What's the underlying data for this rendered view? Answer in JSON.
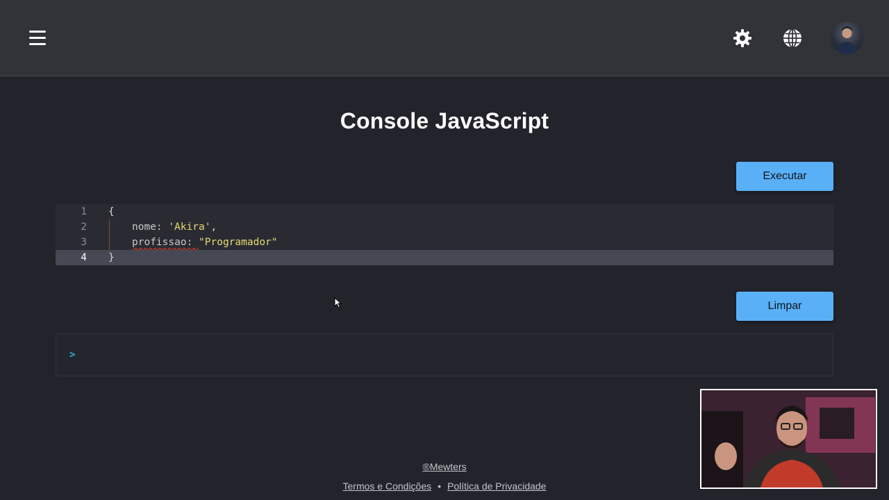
{
  "header": {
    "menu_icon": "hamburger-menu-icon",
    "settings_icon": "gear-icon",
    "language_icon": "globe-icon",
    "avatar_icon": "user-avatar"
  },
  "main": {
    "title": "Console JavaScript",
    "run_button_label": "Executar",
    "clear_button_label": "Limpar"
  },
  "editor": {
    "lines": [
      {
        "number": "1",
        "open": "{"
      },
      {
        "number": "2",
        "key": "nome: ",
        "value": "'Akira'",
        "punct": ","
      },
      {
        "number": "3",
        "key": "profissao: ",
        "value": "\"Programador\""
      },
      {
        "number": "4",
        "close": "}"
      }
    ],
    "active_line": "4"
  },
  "console": {
    "prompt_symbol": ">"
  },
  "footer": {
    "brand": "®Mewters",
    "terms_label": "Termos e Condições",
    "separator": "•",
    "privacy_label": "Política de Privacidade"
  },
  "colors": {
    "background": "#22232b",
    "header": "#323338",
    "accent_button": "#5ab0f7",
    "string_token": "#e6db74",
    "prompt": "#2fb3d4"
  }
}
